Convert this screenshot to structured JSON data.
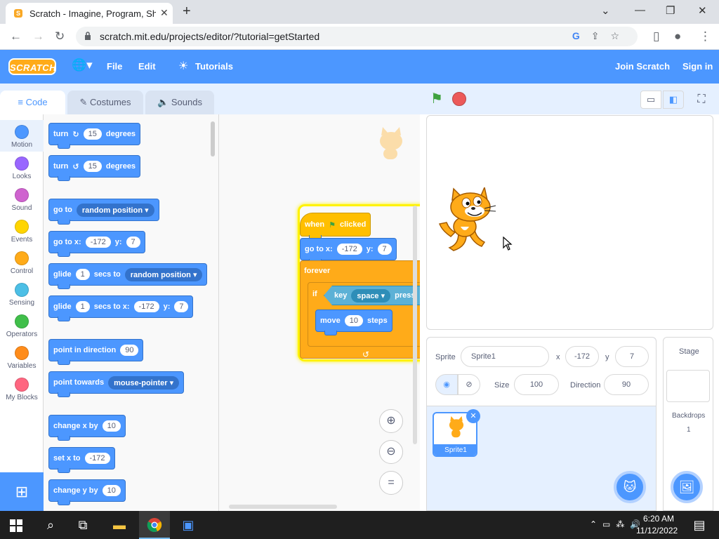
{
  "browser": {
    "tab_title": "Scratch - Imagine, Program, Shar",
    "url": "scratch.mit.edu/projects/editor/?tutorial=getStarted"
  },
  "header": {
    "file": "File",
    "edit": "Edit",
    "tutorials": "Tutorials",
    "join": "Join Scratch",
    "signin": "Sign in"
  },
  "tabs": {
    "code": "Code",
    "costumes": "Costumes",
    "sounds": "Sounds"
  },
  "categories": [
    {
      "label": "Motion",
      "color": "#4c97ff"
    },
    {
      "label": "Looks",
      "color": "#9966ff"
    },
    {
      "label": "Sound",
      "color": "#cf63cf"
    },
    {
      "label": "Events",
      "color": "#ffd500"
    },
    {
      "label": "Control",
      "color": "#ffab19"
    },
    {
      "label": "Sensing",
      "color": "#4cbfe6"
    },
    {
      "label": "Operators",
      "color": "#40bf4a"
    },
    {
      "label": "Variables",
      "color": "#ff8c1a"
    },
    {
      "label": "My Blocks",
      "color": "#ff6680"
    }
  ],
  "palette": {
    "turn": "turn",
    "degrees": "degrees",
    "turn_right_val": "15",
    "turn_left_val": "15",
    "goto": "go to",
    "random_position": "random position",
    "goto_xy": "go to x:",
    "x_val": "-172",
    "y_label": "y:",
    "y_val": "7",
    "glide": "glide",
    "glide_secs": "1",
    "secs_to": "secs to",
    "secs_to_x": "secs to x:",
    "point_dir": "point in direction",
    "dir_val": "90",
    "point_towards": "point towards",
    "mouse_pointer": "mouse-pointer",
    "change_x": "change x by",
    "change_x_val": "10",
    "set_x": "set x to",
    "set_x_val": "-172",
    "change_y": "change y by",
    "change_y_val": "10"
  },
  "script": {
    "when": "when",
    "clicked": "clicked",
    "goto_xy": "go to x:",
    "x_val": "-172",
    "y_label": "y:",
    "y_val": "7",
    "forever": "forever",
    "if": "if",
    "key": "key",
    "key_val": "space",
    "pressed": "press",
    "move": "move",
    "move_val": "10",
    "steps": "steps"
  },
  "sprite_info": {
    "sprite_label": "Sprite",
    "sprite_name": "Sprite1",
    "x_label": "x",
    "x_val": "-172",
    "y_label": "y",
    "y_val": "7",
    "size_label": "Size",
    "size_val": "100",
    "direction_label": "Direction",
    "direction_val": "90",
    "thumb_name": "Sprite1"
  },
  "stage_pane": {
    "title": "Stage",
    "backdrops_label": "Backdrops",
    "backdrops_count": "1"
  },
  "taskbar": {
    "time": "6:20 AM",
    "date": "11/12/2022"
  }
}
